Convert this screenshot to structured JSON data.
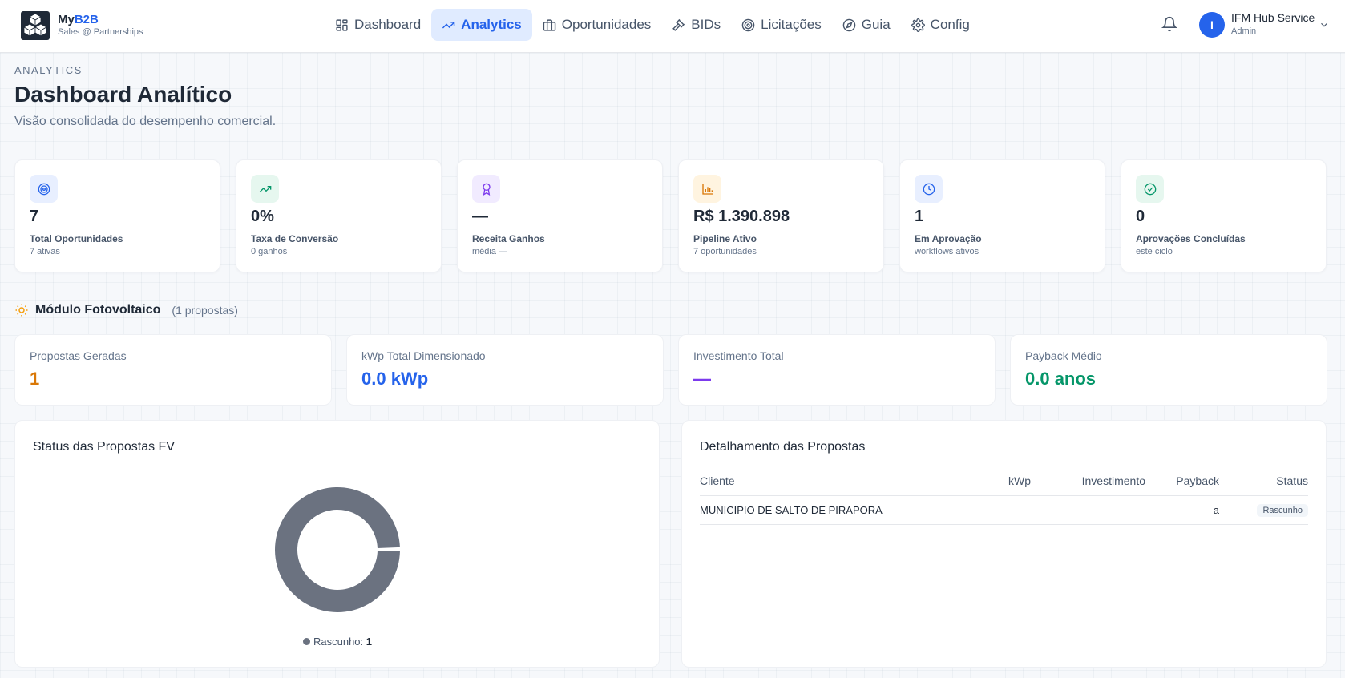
{
  "brand": {
    "name_part1": "My",
    "name_part2": "B2B",
    "subtitle": "Sales @ Partnerships"
  },
  "nav": {
    "items": [
      {
        "label": "Dashboard",
        "icon": "layout-grid-icon",
        "active": false
      },
      {
        "label": "Analytics",
        "icon": "trending-up-icon",
        "active": true
      },
      {
        "label": "Oportunidades",
        "icon": "briefcase-icon",
        "active": false
      },
      {
        "label": "BIDs",
        "icon": "gavel-icon",
        "active": false
      },
      {
        "label": "Licitações",
        "icon": "target-icon",
        "active": false
      },
      {
        "label": "Guia",
        "icon": "compass-icon",
        "active": false
      },
      {
        "label": "Config",
        "icon": "gear-icon",
        "active": false
      }
    ]
  },
  "user": {
    "initial": "I",
    "name": "IFM Hub Service",
    "role": "Admin"
  },
  "header": {
    "eyebrow": "ANALYTICS",
    "title": "Dashboard Analítico",
    "subtitle": "Visão consolidada do desempenho comercial."
  },
  "kpis": [
    {
      "value": "7",
      "label": "Total Oportunidades",
      "sub": "7 ativas",
      "icon": "target-icon",
      "bg": "#e8efff",
      "color": "#2563eb"
    },
    {
      "value": "0%",
      "label": "Taxa de Conversão",
      "sub": "0 ganhos",
      "icon": "trending-up-icon",
      "bg": "#e6f7ef",
      "color": "#059669"
    },
    {
      "value": "—",
      "label": "Receita Ganhos",
      "sub": "média —",
      "icon": "award-icon",
      "bg": "#f1ebff",
      "color": "#7c3aed"
    },
    {
      "value": "R$ 1.390.898",
      "label": "Pipeline Ativo",
      "sub": "7 oportunidades",
      "icon": "bar-chart-icon",
      "bg": "#fff4e0",
      "color": "#d97706"
    },
    {
      "value": "1",
      "label": "Em Aprovação",
      "sub": "workflows ativos",
      "icon": "clock-icon",
      "bg": "#e8efff",
      "color": "#2563eb"
    },
    {
      "value": "0",
      "label": "Aprovações Concluídas",
      "sub": "este ciclo",
      "icon": "check-circle-icon",
      "bg": "#e6f7ef",
      "color": "#059669"
    }
  ],
  "section": {
    "title": "Módulo Fotovoltaico",
    "count": "(1 propostas)",
    "icon": "sun-icon"
  },
  "metrics": [
    {
      "label": "Propostas Geradas",
      "value": "1",
      "color": "#d97706"
    },
    {
      "label": "kWp Total Dimensionado",
      "value": "0.0 kWp",
      "color": "#2563eb"
    },
    {
      "label": "Investimento Total",
      "value": "—",
      "color": "#7c3aed"
    },
    {
      "label": "Payback Médio",
      "value": "0.0 anos",
      "color": "#059669"
    }
  ],
  "status_panel": {
    "title": "Status das Propostas FV",
    "legend_label": "Rascunho:",
    "legend_value": "1",
    "donut_color": "#6b7280"
  },
  "chart_data": {
    "type": "pie",
    "categories": [
      "Rascunho"
    ],
    "values": [
      1
    ]
  },
  "detail_panel": {
    "title": "Detalhamento das Propostas",
    "columns": [
      "Cliente",
      "kWp",
      "Investimento",
      "Payback",
      "Status"
    ],
    "rows": [
      {
        "cliente": "MUNICIPIO DE SALTO DE PIRAPORA",
        "kwp": "",
        "investimento": "—",
        "payback": "a",
        "status": "Rascunho"
      }
    ]
  }
}
